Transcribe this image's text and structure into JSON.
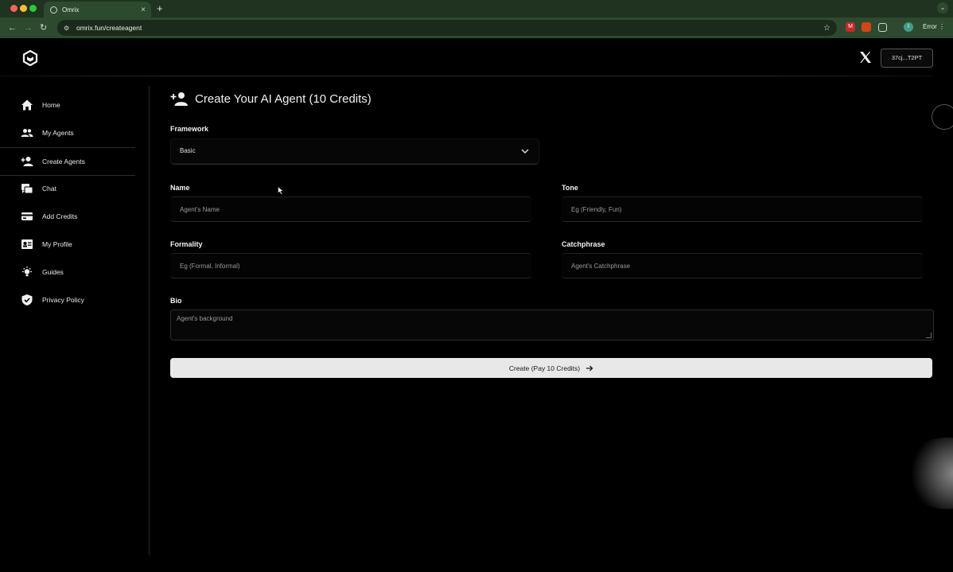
{
  "browser": {
    "tab_title": "Omrix",
    "tab_close": "×",
    "new_tab": "+",
    "url": "omrix.fun/createagent",
    "error_label": "Error",
    "profile_initial": "I",
    "ext_labels": [
      "M",
      "",
      ""
    ]
  },
  "header": {
    "wallet_label": "37cj...T2PT"
  },
  "sidebar": {
    "items": [
      {
        "label": "Home",
        "icon": "home-icon"
      },
      {
        "label": "My Agents",
        "icon": "group-icon"
      },
      {
        "label": "Create Agents",
        "icon": "person-add-icon"
      },
      {
        "label": "Chat",
        "icon": "chat-icon"
      },
      {
        "label": "Add Credits",
        "icon": "credit-card-icon"
      },
      {
        "label": "My Profile",
        "icon": "profile-card-icon"
      },
      {
        "label": "Guides",
        "icon": "lightbulb-icon"
      },
      {
        "label": "Privacy Policy",
        "icon": "shield-check-icon"
      }
    ],
    "active_index": 2
  },
  "form": {
    "title": "Create Your AI Agent (10 Credits)",
    "framework": {
      "label": "Framework",
      "value": "Basic"
    },
    "name": {
      "label": "Name",
      "placeholder": "Agent's Name"
    },
    "tone": {
      "label": "Tone",
      "placeholder": "Eg (Friendly, Fun)"
    },
    "formality": {
      "label": "Formality",
      "placeholder": "Eg (Formal, Informal)"
    },
    "catchphrase": {
      "label": "Catchphrase",
      "placeholder": "Agent's Catchphrase"
    },
    "bio": {
      "label": "Bio",
      "placeholder": "Agent's background"
    },
    "submit_label": "Create (Pay 10 Credits)"
  }
}
